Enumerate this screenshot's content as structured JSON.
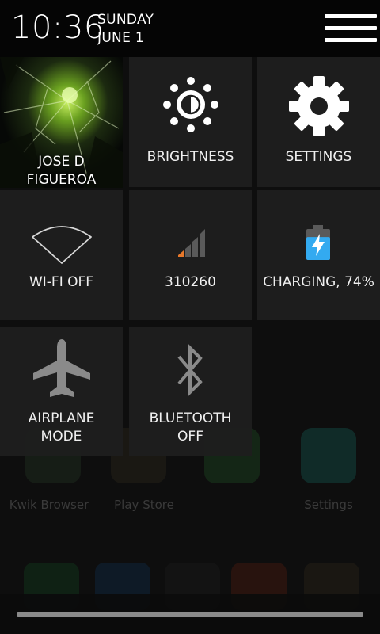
{
  "status_bar": {
    "time": "10:36",
    "day": "SUNDAY",
    "date": "JUNE 1"
  },
  "user": {
    "name": "JOSE D\nFIGUEROA"
  },
  "tiles": {
    "brightness": "BRIGHTNESS",
    "settings": "SETTINGS",
    "wifi": "WI-FI OFF",
    "signal": "310260",
    "battery": "CHARGING, 74%",
    "airplane": "AIRPLANE\nMODE",
    "bluetooth": "BLUETOOTH\nOFF"
  },
  "battery_level": 0.74,
  "colors": {
    "accent_orange": "#e8782a",
    "battery_blue": "#33aaf0",
    "tile_bg": "#1e1e1e"
  },
  "background_labels": {
    "app1": "Kwik Browser",
    "app2": "Play Store",
    "app3": "Settings"
  }
}
